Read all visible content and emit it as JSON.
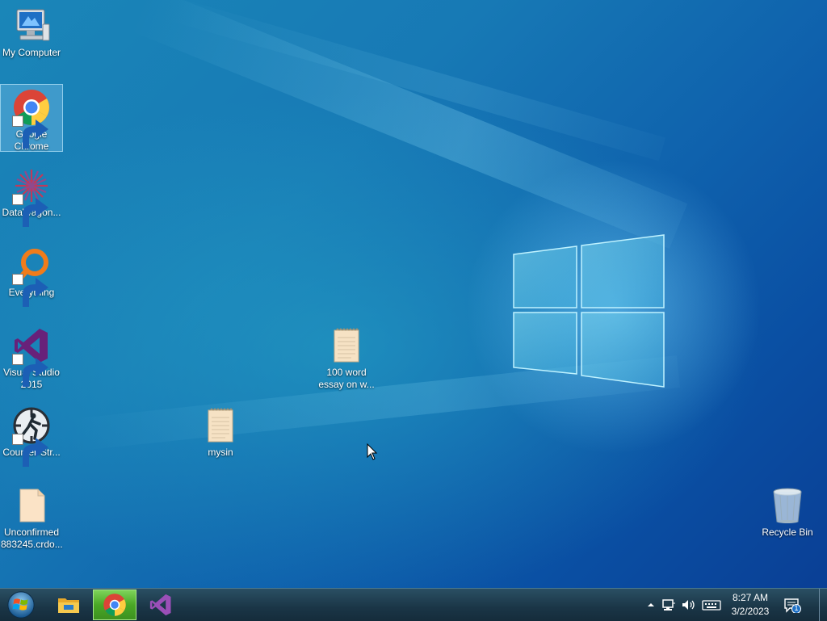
{
  "desktop": {
    "icons": [
      {
        "label": "My Computer",
        "icon": "computer-icon"
      },
      {
        "label": "Google Chrome",
        "icon": "chrome-icon",
        "selected": true
      },
      {
        "label": "DataWagon...",
        "icon": "datawagon-icon"
      },
      {
        "label": "Everything",
        "icon": "everything-search-icon"
      },
      {
        "label": "Visual Studio 2015",
        "icon": "visual-studio-icon"
      },
      {
        "label": "Counter-Str...",
        "icon": "counter-strike-icon"
      },
      {
        "label": "Unconfirmed 883245.crdo...",
        "icon": "file-icon"
      },
      {
        "label": "mysin",
        "icon": "text-file-icon"
      },
      {
        "label": "100 word essay on w...",
        "icon": "text-file-icon"
      },
      {
        "label": "Recycle Bin",
        "icon": "recycle-bin-icon"
      }
    ]
  },
  "taskbar": {
    "start": {
      "icon": "windows-start-orb-icon"
    },
    "pinned": [
      {
        "name": "File Explorer",
        "icon": "file-explorer-icon"
      },
      {
        "name": "Google Chrome",
        "icon": "chrome-icon",
        "active": true
      },
      {
        "name": "Visual Studio",
        "icon": "visual-studio-icon"
      }
    ],
    "tray": {
      "icons": [
        "chevron-up-icon",
        "network-icon",
        "volume-icon",
        "keyboard-icon"
      ],
      "time": "8:27 AM",
      "date": "3/2/2023",
      "notification_count": "1"
    }
  },
  "colors": {
    "desktop_primary": "#1779b5",
    "taskbar": "#1a3546",
    "active_button": "#4aa826"
  }
}
